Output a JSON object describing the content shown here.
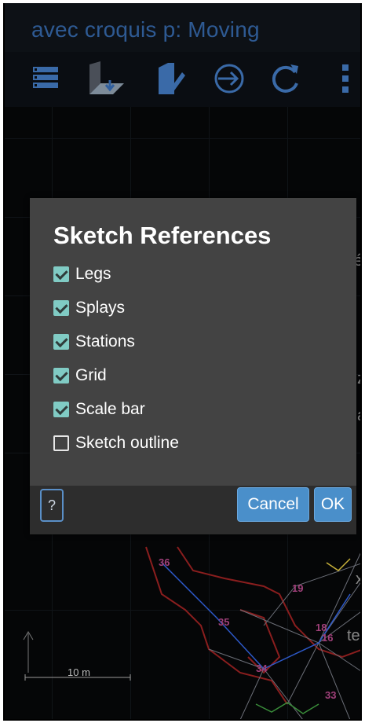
{
  "window": {
    "title": "avec croquis p: Moving"
  },
  "toolbar": {
    "icons": [
      "menu-list-icon",
      "download-plane-icon",
      "edit-note-icon",
      "arrow-circle-icon",
      "refresh-icon",
      "more-vert-icon"
    ]
  },
  "canvas": {
    "stations": [
      "36",
      "35",
      "19",
      "18",
      "16",
      "34",
      "33"
    ],
    "side_chars": [
      "é",
      "z",
      "a",
      "x",
      "te"
    ],
    "scale_bar_label": "10 m"
  },
  "dialog": {
    "title": "Sketch References",
    "options": [
      {
        "label": "Legs",
        "checked": true
      },
      {
        "label": "Splays",
        "checked": true
      },
      {
        "label": "Stations",
        "checked": true
      },
      {
        "label": "Grid",
        "checked": true
      },
      {
        "label": "Scale bar",
        "checked": true
      },
      {
        "label": "Sketch outline",
        "checked": false
      }
    ],
    "help_label": "?",
    "cancel_label": "Cancel",
    "ok_label": "OK"
  },
  "colors": {
    "title_text": "#2e5a93",
    "toolbar_icon": "#3a6aa8",
    "checkbox_on": "#80cbc4",
    "button_blue": "#4a8fca",
    "dialog_bg": "#434343"
  }
}
